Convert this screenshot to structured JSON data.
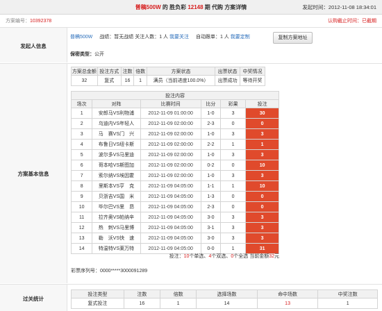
{
  "header": {
    "title_prefix": "普稿500W",
    "title_middle": " 的 胜负彩 ",
    "issue": "12148",
    "title_suffix": " 期 代购 方案详情",
    "pub_label": "发起时间：",
    "pub_time": "2012-11-08 18:34:01"
  },
  "scheme": {
    "id_label": "方案编号：",
    "id_value": "10392378",
    "deadline": "认购截止时间：已截期"
  },
  "initiator": {
    "section_label": "发起人信息",
    "user": "普稿500W",
    "record_label": "战绩：",
    "record_value": "暂无战绩",
    "follow_label": "关注人数：",
    "follow_value": "1 人",
    "follow_link": "我要关注",
    "auto_label": "自动跟单：",
    "auto_value": "1 人",
    "auto_link": "我要定制",
    "copy_button": "复制方案地址",
    "privacy_label": "保密类型：",
    "privacy_value": "公开"
  },
  "summary": {
    "section_label": "方案基本信息",
    "headers": [
      "方案总金额",
      "投注方式",
      "注数",
      "倍数",
      "方案状态",
      "出票状态",
      "中奖情况"
    ],
    "row": [
      "32",
      "复式",
      "16",
      "1",
      "满员（当前进度100.0%）",
      "出票成功",
      "等待开奖"
    ]
  },
  "bets": {
    "caption": "投注内容",
    "headers": [
      "场次",
      "对阵",
      "比赛时间",
      "比分",
      "彩果",
      "投注"
    ],
    "rows": [
      [
        "1",
        "安郎马VS利物浦",
        "2012-11-09 01:00:00",
        "1-0",
        "3",
        "30"
      ],
      [
        "2",
        "乌迪内VS年轻人",
        "2012-11-09 02:00:00",
        "2-3",
        "0",
        "0"
      ],
      [
        "3",
        "马　赛VS门　兴",
        "2012-11-09 02:00:00",
        "1-0",
        "3",
        "3"
      ],
      [
        "4",
        "布鲁日VS纽卡斯",
        "2012-11-09 02:00:00",
        "2-2",
        "1",
        "1"
      ],
      [
        "5",
        "波尔多VS马里迪",
        "2012-11-09 02:00:00",
        "1-0",
        "3",
        "3"
      ],
      [
        "6",
        "哥本哈VS斯图加",
        "2012-11-09 02:00:00",
        "0-2",
        "0",
        "10"
      ],
      [
        "7",
        "索尔纳VS埃因霍",
        "2012-11-09 02:00:00",
        "1-0",
        "3",
        "3"
      ],
      [
        "8",
        "里斯本VS亨　克",
        "2012-11-09 04:05:00",
        "1-1",
        "1",
        "10"
      ],
      [
        "9",
        "贝浙吉VS国　米",
        "2012-11-09 04:05:00",
        "1-3",
        "0",
        "0"
      ],
      [
        "10",
        "毕尔巴VS里　昂",
        "2012-11-09 04:05:00",
        "2-3",
        "0",
        "0"
      ],
      [
        "11",
        "拉齐奥VS帕纳辛",
        "2012-11-09 04:05:00",
        "3-0",
        "3",
        "3"
      ],
      [
        "12",
        "热　刺VS马里博",
        "2012-11-09 04:05:00",
        "3-1",
        "3",
        "3"
      ],
      [
        "13",
        "勒　沃VS快　速",
        "2012-11-09 04:05:00",
        "3-0",
        "3",
        "3"
      ],
      [
        "14",
        "特温特VS莱万特",
        "2012-11-09 04:05:00",
        "0-0",
        "1",
        "31"
      ]
    ],
    "footer_p1": "投注：",
    "footer_singles": "10",
    "footer_p2": "个单选、",
    "footer_doubles": "4",
    "footer_p3": "个双选、",
    "footer_triples": "0",
    "footer_p4": "个全选 当前金额",
    "footer_amount": "32",
    "footer_p5": "元",
    "serial_label": "彩票序列号：",
    "serial_value": "0000*****3000091289"
  },
  "stats": {
    "section_label": "过关统计",
    "headers": [
      "投注类型",
      "注数",
      "倍数",
      "选择场数",
      "命中场数",
      "中奖注数"
    ],
    "row": [
      "复式投注",
      "16",
      "1",
      "14",
      "13",
      "1"
    ]
  }
}
